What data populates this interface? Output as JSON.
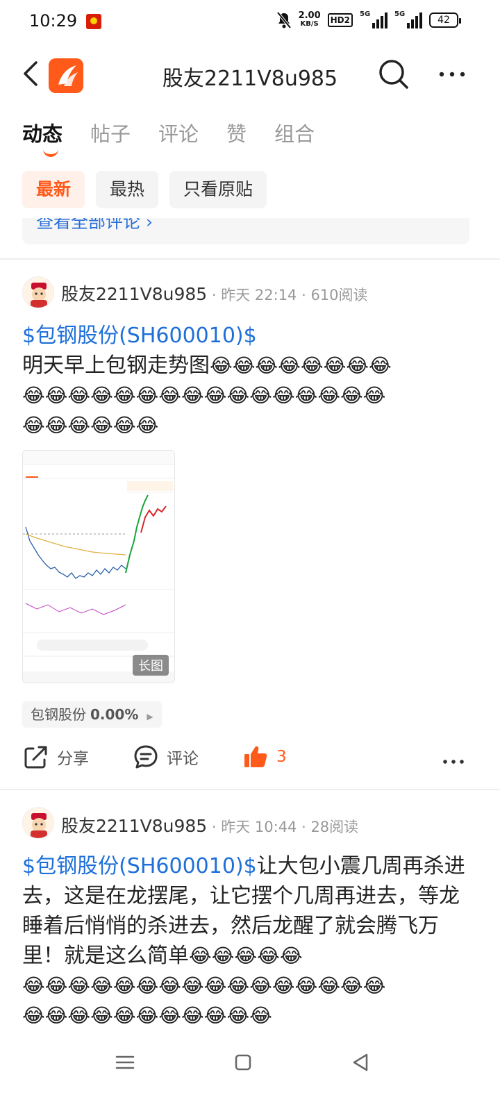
{
  "status": {
    "time": "10:29",
    "net_speed_value": "2.00",
    "net_speed_unit": "KB/S",
    "hd_label": "HD2",
    "sim1": "5G",
    "sim2": "5G",
    "battery": "42"
  },
  "nav": {
    "title": "股友2211V8u985"
  },
  "tabs": [
    "动态",
    "帖子",
    "评论",
    "赞",
    "组合"
  ],
  "filters": [
    "最新",
    "最热",
    "只看原贴"
  ],
  "view_all": "查看全部评论 ›",
  "posts": [
    {
      "author": "股友2211V8u985",
      "meta": " · 昨天 22:14 · 610阅读",
      "stock_link": "$包钢股份(SH600010)$",
      "text_line": "明天早上包钢走势图",
      "emojis_1": "😂😂😂😂😂😂😂😂",
      "emojis_2": "😂😂😂😂😂😂😂😂😂😂😂😂😂😂😂😂",
      "emojis_3": "😂😂😂😂😂😂",
      "image_tag": "长图",
      "stock_chip_name": "包钢股份",
      "stock_chip_change": "0.00%",
      "share_label": "分享",
      "comment_label": "评论",
      "like_count": "3"
    },
    {
      "author": "股友2211V8u985",
      "meta": " · 昨天 10:44 · 28阅读",
      "stock_link": "$包钢股份(SH600010)$",
      "text": "让大包小震几周再杀进去，这是在龙摆尾，让它摆个几周再进去，等龙睡着后悄悄的杀进去，然后龙醒了就会腾飞万里！就是这么简单",
      "emojis_1": "😂😂😂😂😂",
      "emojis_2": "😂😂😂😂😂😂😂😂😂😂😂😂😂😂😂😂",
      "emojis_3": "😂😂😂😂😂😂😂😂😂😂😂"
    }
  ],
  "colors": {
    "accent": "#ff5a1a",
    "link": "#1e6fd9"
  }
}
